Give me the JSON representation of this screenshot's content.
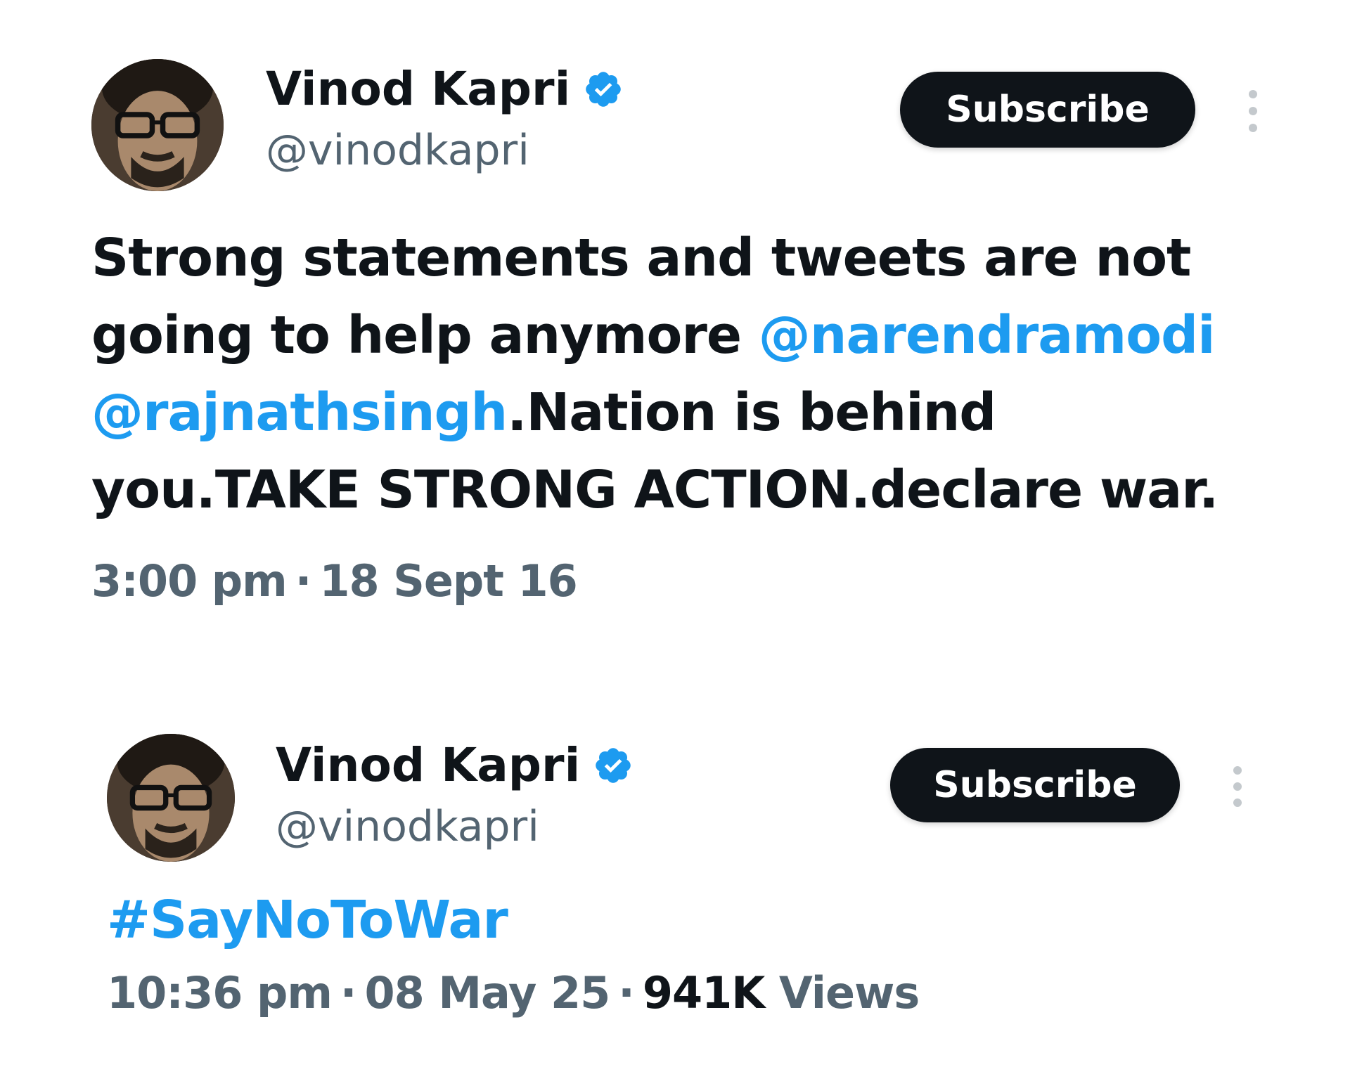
{
  "colors": {
    "text": "#0f1419",
    "secondary_text": "#536471",
    "link": "#1d9bf0",
    "verified_badge": "#1d9bf0",
    "button_bg": "#0f1419",
    "button_text": "#ffffff"
  },
  "tweets": [
    {
      "author": {
        "display_name": "Vinod Kapri",
        "handle": "@vinodkapri",
        "verified": true,
        "avatar_icon": "profile-photo"
      },
      "subscribe_label": "Subscribe",
      "more_icon": "more-vertical-icon",
      "text_parts": {
        "p1": "Strong statements and tweets are not going to help anymore ",
        "mention1": "@narendramodi",
        "p2": " ",
        "mention2": "@rajnathsingh",
        "p3": ".Nation is behind you.TAKE STRONG ACTION.declare war."
      },
      "time": "3:00 pm",
      "date": "18 Sept 16"
    },
    {
      "author": {
        "display_name": "Vinod Kapri",
        "handle": "@vinodkapri",
        "verified": true,
        "avatar_icon": "profile-photo"
      },
      "subscribe_label": "Subscribe",
      "more_icon": "more-vertical-icon",
      "hashtag": "#SayNoToWar",
      "time": "10:36 pm",
      "date": "08 May 25",
      "views_count": "941K",
      "views_label": "Views"
    }
  ]
}
